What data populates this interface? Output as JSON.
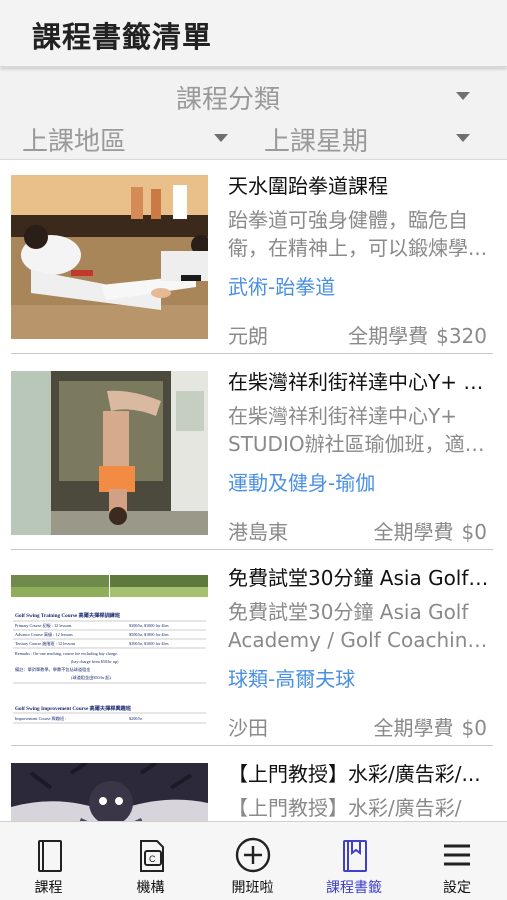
{
  "header": {
    "title": "課程書籤清單"
  },
  "filters": {
    "category": "課程分類",
    "area": "上課地區",
    "weekday": "上課星期"
  },
  "courses": [
    {
      "title": "天水圍跆拳道課程",
      "description": "跆拳道可強身健體，臨危自衛，在精神上，可以鍛煉學...",
      "category": "武術-跆拳道",
      "region": "元朗",
      "fee_label": "全期學費",
      "fee": "$320",
      "image": "taekwondo-photo"
    },
    {
      "title": "在柴灣祥利街祥達中心Y+ ST...",
      "description": "在柴灣祥利街祥達中心Y+ STUDIO辦社區瑜伽班，適合...",
      "category": "運動及健身-瑜伽",
      "region": "港島東",
      "fee_label": "全期學費",
      "fee": "$0",
      "image": "yoga-photo"
    },
    {
      "title": "免費試堂30分鐘 Asia Golf A...",
      "description": "免費試堂30分鐘 Asia Golf Academy / Golf Coaching / ...",
      "category": "球類-高爾夫球",
      "region": "沙田",
      "fee_label": "全期學費",
      "fee": "$0",
      "image": "golf-price-table",
      "image_text": {
        "t1": "Golf Swing Training Course 高爾夫揮桿訓練班",
        "r1a": "Primary Course 初級 : 12 lessons",
        "r1b": "$300/hr, $1000 for 4hrs",
        "r2a": "Advance Course 高級 : 12 lessons",
        "r2b": "$500/hr, $1800 for 4hrs",
        "r3a": "Tertiary Course 進階班 : 12 lessons",
        "r3b": "$300/hr, $1000 for 4hrs",
        "r4": "Remarks : On-one teaching, course fee excluding bay charge.",
        "r5": "(bay charge from $50/hr up)",
        "r6": "備註：單對單教學，學費不包括球道租金",
        "r7": "(球道租金由$50/hr 起)",
        "t2": "Golf Swing Improvement Course 高爾夫揮桿興趣班",
        "r8a": "Improvement Course 興趣班 :",
        "r8b": "$200/hr"
      }
    },
    {
      "title": "【上門教授】水彩/廣告彩/...",
      "description": "【上門教授】水彩/廣告彩/素...",
      "category": "",
      "region": "",
      "fee_label": "",
      "fee": "",
      "image": "manga-artwork"
    }
  ],
  "tabbar": {
    "items": [
      {
        "label": "課程",
        "icon": "book-icon"
      },
      {
        "label": "機構",
        "icon": "organization-card-icon"
      },
      {
        "label": "開班啦",
        "icon": "add-circle-icon"
      },
      {
        "label": "課程書籤",
        "icon": "bookmark-book-icon",
        "active": true
      },
      {
        "label": "設定",
        "icon": "menu-icon"
      }
    ],
    "active_color": "#3f3fc8"
  },
  "colors": {
    "category_link": "#4a90e2",
    "header_bg": "#f3f3f3",
    "muted_text": "#8a8a8a"
  }
}
